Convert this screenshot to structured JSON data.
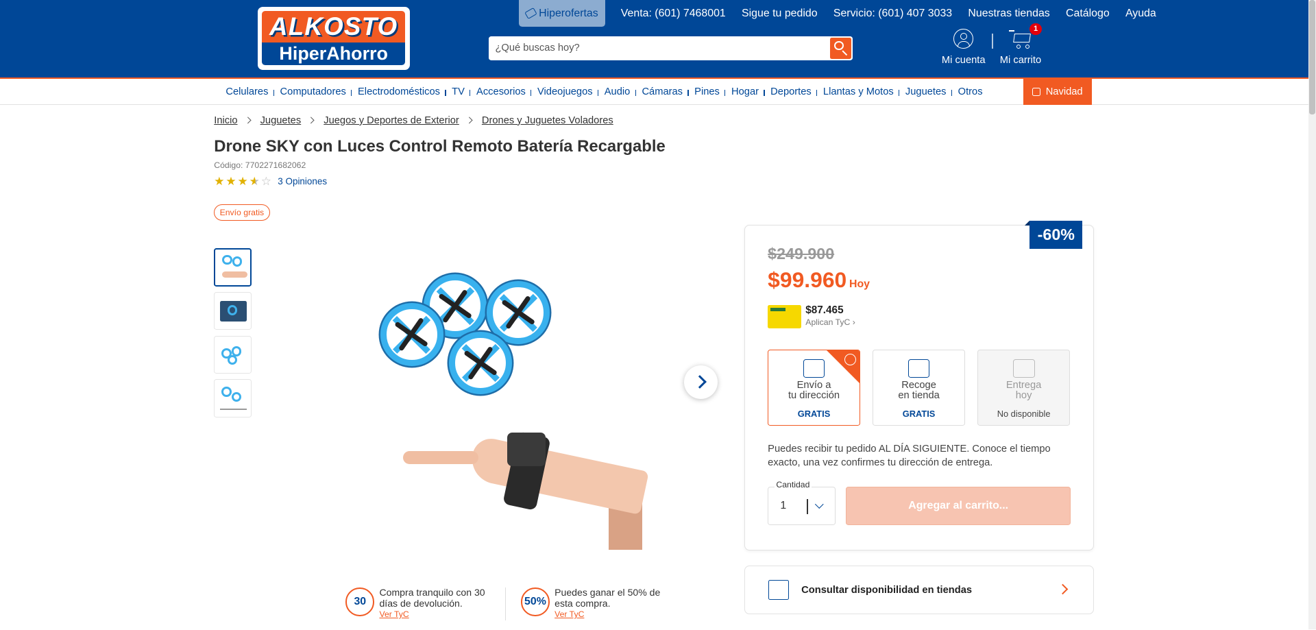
{
  "header": {
    "logo_top": "ALKOSTO",
    "logo_bottom": "HiperAhorro",
    "hiperofertas": "Hiperofertas",
    "links": [
      "Venta: (601) 7468001",
      "Sigue tu pedido",
      "Servicio: (601) 407 3033",
      "Nuestras tiendas",
      "Catálogo",
      "Ayuda"
    ],
    "search_placeholder": "¿Qué buscas hoy?",
    "account_label": "Mi cuenta",
    "cart_label": "Mi carrito",
    "cart_count": "1"
  },
  "nav": {
    "items": [
      "Celulares",
      "Computadores",
      "Electrodomésticos",
      "TV",
      "Accesorios",
      "Videojuegos",
      "Audio",
      "Cámaras",
      "Pines",
      "Hogar",
      "Deportes",
      "Llantas y Motos",
      "Juguetes",
      "Otros"
    ],
    "highlight": "Navidad"
  },
  "breadcrumb": [
    "Inicio",
    "Juguetes",
    "Juegos y Deportes de Exterior",
    "Drones y Juguetes Voladores"
  ],
  "product": {
    "title": "Drone SKY con Luces Control Remoto Batería Recargable",
    "code": "Código: 7702271682062",
    "rating": 3.5,
    "opinions": "3 Opiniones",
    "shipping_badge": "Envío gratis"
  },
  "price": {
    "discount": "-60%",
    "old": "$249.900",
    "current": "$99.960",
    "today": "Hoy",
    "card_price": "$87.465",
    "card_terms": "Aplican TyC"
  },
  "delivery": {
    "options": [
      {
        "line1": "Envío a",
        "line2": "tu dirección",
        "status": "GRATIS"
      },
      {
        "line1": "Recoge",
        "line2": "en tienda",
        "status": "GRATIS"
      },
      {
        "line1": "Entrega",
        "line2": "hoy",
        "status": "No disponible"
      }
    ],
    "note": "Puedes recibir tu pedido AL DÍA SIGUIENTE. Conoce el tiempo exacto, una vez confirmes tu dirección de entrega."
  },
  "purchase": {
    "qty_label": "Cantidad",
    "qty_value": "1",
    "add_to_cart": "Agregar al carrito..."
  },
  "availability": "Consultar disponibilidad en tiendas",
  "promos": [
    {
      "badge": "30",
      "text": "Compra tranquilo con 30 días de devolución.",
      "link": "Ver TyC"
    },
    {
      "badge": "50%",
      "text": "Puedes ganar el 50% de esta compra.",
      "link": "Ver TyC"
    }
  ],
  "colors": {
    "brand_blue": "#004797",
    "brand_orange": "#f15a22",
    "star": "#e1b100"
  }
}
